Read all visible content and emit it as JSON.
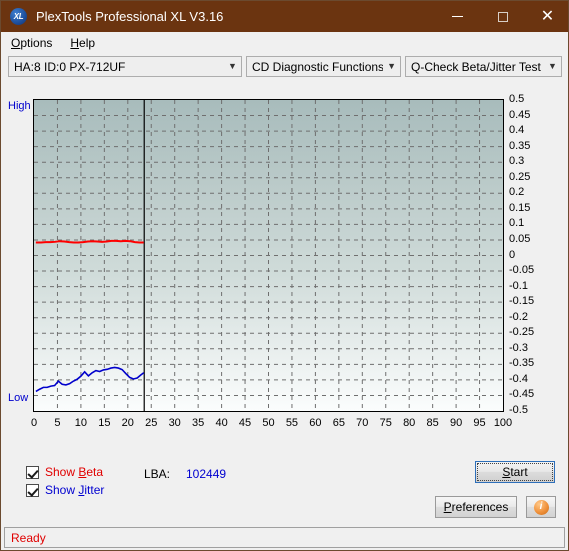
{
  "window": {
    "title": "PlexTools Professional XL V3.16",
    "icon_label": "XL",
    "minimize_label": "Minimize",
    "maximize_label": "Maximize",
    "close_label": "Close"
  },
  "menubar": {
    "items": [
      {
        "label": "Options",
        "accel": "O"
      },
      {
        "label": "Help",
        "accel": "H"
      }
    ]
  },
  "toolbar": {
    "drive_select": "HA:8 ID:0  PX-712UF",
    "function_select": "CD Diagnostic Functions",
    "test_select": "Q-Check Beta/Jitter Test"
  },
  "chart_data": {
    "type": "line",
    "title": "",
    "xlabel": "",
    "ylabel": "",
    "y_axis_left_top_label": "High",
    "y_axis_left_bottom_label": "Low",
    "xlim": [
      0,
      100
    ],
    "ylim": [
      -0.5,
      0.5
    ],
    "xticks": [
      0,
      5,
      10,
      15,
      20,
      25,
      30,
      35,
      40,
      45,
      50,
      55,
      60,
      65,
      70,
      75,
      80,
      85,
      90,
      95,
      100
    ],
    "yticks": [
      0.5,
      0.45,
      0.4,
      0.35,
      0.3,
      0.25,
      0.2,
      0.15,
      0.1,
      0.05,
      0,
      -0.05,
      -0.1,
      -0.15,
      -0.2,
      -0.25,
      -0.3,
      -0.35,
      -0.4,
      -0.45,
      -0.5
    ],
    "grid": true,
    "legend_position": "none",
    "cursor_x": 23.5,
    "series": [
      {
        "name": "Beta",
        "color": "#ff0000",
        "x": [
          0.4,
          1.5,
          2.5,
          3.5,
          4.5,
          5.5,
          6.5,
          7.5,
          8.5,
          9.5,
          10.5,
          11.5,
          12.5,
          13.5,
          14.5,
          15.5,
          16.5,
          17.5,
          18.5,
          19.5,
          20.5,
          21.5,
          22.5,
          23.4
        ],
        "y": [
          0.042,
          0.042,
          0.043,
          0.043,
          0.044,
          0.046,
          0.045,
          0.043,
          0.042,
          0.042,
          0.043,
          0.045,
          0.046,
          0.045,
          0.044,
          0.045,
          0.047,
          0.047,
          0.046,
          0.047,
          0.046,
          0.043,
          0.042,
          0.042
        ]
      },
      {
        "name": "Jitter",
        "color": "#0000cc",
        "x": [
          0.4,
          1.2,
          2.0,
          2.8,
          3.6,
          4.4,
          5.2,
          6.0,
          6.8,
          7.6,
          8.4,
          9.2,
          10.0,
          10.8,
          11.6,
          12.4,
          13.2,
          14.0,
          14.8,
          15.6,
          16.4,
          17.2,
          18.0,
          18.8,
          19.6,
          20.4,
          21.2,
          22.0,
          22.7,
          23.4
        ],
        "y": [
          -0.437,
          -0.43,
          -0.424,
          -0.424,
          -0.42,
          -0.418,
          -0.404,
          -0.414,
          -0.416,
          -0.412,
          -0.404,
          -0.398,
          -0.388,
          -0.374,
          -0.387,
          -0.377,
          -0.37,
          -0.373,
          -0.368,
          -0.366,
          -0.362,
          -0.36,
          -0.362,
          -0.367,
          -0.38,
          -0.392,
          -0.397,
          -0.394,
          -0.385,
          -0.377
        ]
      }
    ]
  },
  "controls": {
    "show_beta": {
      "label_pre": "Show ",
      "label_accel": "B",
      "label_post": "eta",
      "checked": true
    },
    "show_jitter": {
      "label_pre": "Show ",
      "label_accel": "J",
      "label_post": "itter",
      "checked": true
    },
    "lba_label": "LBA:",
    "lba_value": "102449",
    "start_button": {
      "pre": "",
      "accel": "S",
      "post": "tart"
    },
    "preferences_button": {
      "pre": "",
      "accel": "P",
      "post": "references"
    },
    "info_button": {
      "glyph": "i"
    }
  },
  "statusbar": {
    "text": "Ready"
  }
}
